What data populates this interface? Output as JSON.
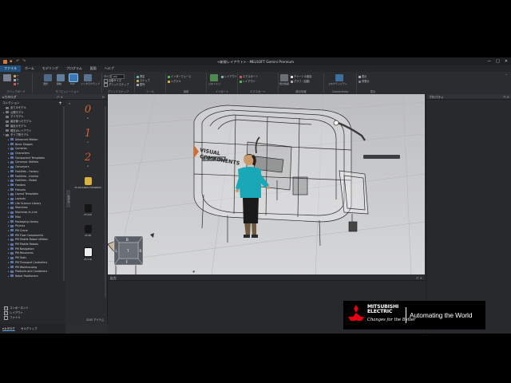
{
  "window": {
    "title": "<新規レイアウト> - MELSOFT Gemini Premium",
    "controls": [
      "—",
      "□",
      "✕"
    ]
  },
  "menu": {
    "items": [
      "ファイル",
      "ホーム",
      "モデリング",
      "プログラム",
      "図面",
      "ヘルプ"
    ],
    "active_index": 0
  },
  "ribbon": {
    "groups": [
      {
        "label": "クリップボード"
      },
      {
        "label": "マニピュレーション"
      },
      {
        "label": "グリッドスナップ"
      },
      {
        "label": "ツール"
      },
      {
        "label": "接続"
      },
      {
        "label": "インポート"
      },
      {
        "label": "エクスポート"
      },
      {
        "label": "統計情報"
      },
      {
        "label": "Connectivity"
      },
      {
        "label": "表示"
      }
    ],
    "buttons": {
      "select": "選択",
      "move": "移動",
      "pnp": "PnP",
      "interactive": "インタラクティブ",
      "size_label": "サイズ",
      "size_value": "100",
      "grid_check": "自動サイズ",
      "grid_snap": "グリッドスナップ",
      "measure": "測定",
      "snap": "スナップ",
      "align": "整列",
      "interface": "インターフェース",
      "signal": "シグナル",
      "geometry": "ジオメトリ",
      "layout": "レイアウト",
      "export": "エクスポート",
      "report": "統計情報",
      "chart": "チャートの追加",
      "add_chart": "グラフ（自動）",
      "connectivity": "コネクティビティ",
      "show": "表示",
      "hide": "非表示"
    }
  },
  "collections_panel": {
    "title": "eカタログ",
    "section": "コレクション",
    "items": [
      {
        "label": "全てのモデル",
        "depth": 1,
        "arrow": ""
      },
      {
        "label": "公開モデル",
        "depth": 1,
        "arrow": "▸"
      },
      {
        "label": "マイモデル",
        "depth": 1,
        "arrow": ""
      },
      {
        "label": "最近使ったモデル",
        "depth": 1,
        "arrow": ""
      },
      {
        "label": "最近のモデル",
        "depth": 1,
        "arrow": ""
      },
      {
        "label": "現在のレイアウト",
        "depth": 1,
        "arrow": ""
      },
      {
        "label": "タイプ別モデル",
        "depth": 1,
        "arrow": "▾"
      },
      {
        "label": "Advanced Motion",
        "depth": 2,
        "arrow": "▸"
      },
      {
        "label": "Basic Shapes",
        "depth": 2,
        "arrow": "▸"
      },
      {
        "label": "Cameras",
        "depth": 2,
        "arrow": "▸"
      },
      {
        "label": "Characters",
        "depth": 2,
        "arrow": "▸"
      },
      {
        "label": "Component Templates",
        "depth": 2,
        "arrow": "▸"
      },
      {
        "label": "Conveyor Utilities",
        "depth": 2,
        "arrow": "▸"
      },
      {
        "label": "Conveyors",
        "depth": 2,
        "arrow": "▸"
      },
      {
        "label": "Facilities - Factory",
        "depth": 2,
        "arrow": "▸"
      },
      {
        "label": "Facilities - Interior",
        "depth": 2,
        "arrow": "▸"
      },
      {
        "label": "Facilities - Robot",
        "depth": 2,
        "arrow": "▸"
      },
      {
        "label": "Feeders",
        "depth": 2,
        "arrow": "▸"
      },
      {
        "label": "Fixtures",
        "depth": 2,
        "arrow": "▸"
      },
      {
        "label": "Layout Templates",
        "depth": 2,
        "arrow": "▸"
      },
      {
        "label": "Layouts",
        "depth": 2,
        "arrow": "▸"
      },
      {
        "label": "Life Science Library",
        "depth": 2,
        "arrow": "▸"
      },
      {
        "label": "Machines",
        "depth": 2,
        "arrow": "▸"
      },
      {
        "label": "Machines In-Line",
        "depth": 2,
        "arrow": "▸"
      },
      {
        "label": "Misc",
        "depth": 2,
        "arrow": "▸"
      },
      {
        "label": "Packaging Library",
        "depth": 2,
        "arrow": "▸"
      },
      {
        "label": "Physics",
        "depth": 2,
        "arrow": "▸"
      },
      {
        "label": "PM Crane",
        "depth": 2,
        "arrow": "▸"
      },
      {
        "label": "PM Flow Components",
        "depth": 2,
        "arrow": "▸"
      },
      {
        "label": "PM Mobile Robot Utilities",
        "depth": 2,
        "arrow": "▸"
      },
      {
        "label": "PM Mobile Robots",
        "depth": 2,
        "arrow": "▸"
      },
      {
        "label": "PM Navigation",
        "depth": 2,
        "arrow": "▸"
      },
      {
        "label": "PM Resources",
        "depth": 2,
        "arrow": "▸"
      },
      {
        "label": "PM Tools",
        "depth": 2,
        "arrow": "▸"
      },
      {
        "label": "PM Transport Controllers",
        "depth": 2,
        "arrow": "▸"
      },
      {
        "label": "PM Warehousing",
        "depth": 2,
        "arrow": "▸"
      },
      {
        "label": "Products and Containers",
        "depth": 2,
        "arrow": "▸"
      },
      {
        "label": "Robot Positioners",
        "depth": 2,
        "arrow": "▸"
      }
    ],
    "checks": [
      {
        "label": "コンポーネント",
        "checked": true
      },
      {
        "label": "レイアウト",
        "checked": true
      },
      {
        "label": "ファイル",
        "checked": false
      }
    ],
    "tabs": [
      "eカタログ",
      "セルグリップ"
    ]
  },
  "item_strip": {
    "items": [
      {
        "label": "0",
        "glyph": "0"
      },
      {
        "label": "1",
        "glyph": "1"
      },
      {
        "label": "2",
        "glyph": "2"
      },
      {
        "label": "2F-AM-34RVG FOXSERVO",
        "glyph": ""
      },
      {
        "label": "2F-VAD",
        "glyph": ""
      },
      {
        "label": "2F-VB",
        "glyph": ""
      },
      {
        "label": "2F-V1N",
        "glyph": ""
      }
    ],
    "footer": "3245 アイテム",
    "side_tab": "モデル"
  },
  "viewport": {
    "machine_brand_line1": "VISUAL",
    "machine_brand_line2": "COMPONENTS",
    "nav_cube": {
      "top": "B",
      "left": "L",
      "front": "T",
      "right": "R",
      "bottom": "F"
    }
  },
  "output_panel": {
    "title": "出力"
  },
  "properties_panel": {
    "title": "プロパティ"
  },
  "brand": {
    "name_line1": "MITSUBISHI",
    "name_line2": "ELECTRIC",
    "tagline": "Changes for the Better",
    "slogan": "Automating the World"
  }
}
